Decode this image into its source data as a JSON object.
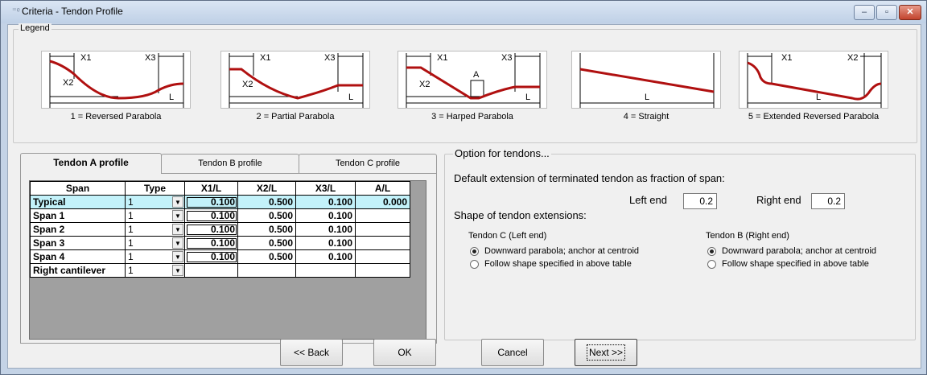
{
  "window": {
    "title": "Criteria - Tendon Profile",
    "minimize": "–",
    "restore": "▫",
    "close": "✕"
  },
  "legend": {
    "label": "Legend",
    "items": [
      {
        "caption": "1 = Reversed Parabola",
        "labels": [
          "X1",
          "X3",
          "X2",
          "L"
        ]
      },
      {
        "caption": "2 = Partial Parabola",
        "labels": [
          "X1",
          "X3",
          "X2",
          "L"
        ]
      },
      {
        "caption": "3 = Harped Parabola",
        "labels": [
          "X1",
          "X3",
          "X2",
          "A",
          "L"
        ]
      },
      {
        "caption": "4 = Straight",
        "labels": [
          "L"
        ]
      },
      {
        "caption": "5 = Extended Reversed Parabola",
        "labels": [
          "X1",
          "X2",
          "L"
        ]
      }
    ]
  },
  "tabs": [
    {
      "label": "Tendon A profile",
      "active": true
    },
    {
      "label": "Tendon B profile",
      "active": false
    },
    {
      "label": "Tendon C profile",
      "active": false
    }
  ],
  "grid": {
    "headers": [
      "Span",
      "Type",
      "X1/L",
      "X2/L",
      "X3/L",
      "A/L"
    ],
    "rows": [
      {
        "span": "Typical",
        "type": "1",
        "x1": "0.100",
        "x2": "0.500",
        "x3": "0.100",
        "a": "0.000"
      },
      {
        "span": "Span 1",
        "type": "1",
        "x1": "0.100",
        "x2": "0.500",
        "x3": "0.100",
        "a": ""
      },
      {
        "span": "Span 2",
        "type": "1",
        "x1": "0.100",
        "x2": "0.500",
        "x3": "0.100",
        "a": ""
      },
      {
        "span": "Span 3",
        "type": "1",
        "x1": "0.100",
        "x2": "0.500",
        "x3": "0.100",
        "a": ""
      },
      {
        "span": "Span 4",
        "type": "1",
        "x1": "0.100",
        "x2": "0.500",
        "x3": "0.100",
        "a": ""
      },
      {
        "span": "Right cantilever",
        "type": "1",
        "x1": "",
        "x2": "",
        "x3": "",
        "a": ""
      }
    ]
  },
  "options": {
    "group_label": "Option for tendons...",
    "default_extension_label": "Default extension of terminated tendon as fraction of span:",
    "left_end_label": "Left end",
    "left_end_value": "0.2",
    "right_end_label": "Right end",
    "right_end_value": "0.2",
    "shape_label": "Shape of tendon extensions:",
    "tendon_c": {
      "title": "Tendon C (Left end)",
      "opt1": "Downward parabola; anchor at centroid",
      "opt2": "Follow shape specified in above table"
    },
    "tendon_b": {
      "title": "Tendon B (Right end)",
      "opt1": "Downward parabola; anchor at centroid",
      "opt2": "Follow shape specified in above table"
    }
  },
  "buttons": {
    "back": "<< Back",
    "ok": "OK",
    "cancel": "Cancel",
    "next": "Next >>"
  },
  "colors": {
    "tendon": "#b01010",
    "highlight_row": "#c3f2fa"
  }
}
